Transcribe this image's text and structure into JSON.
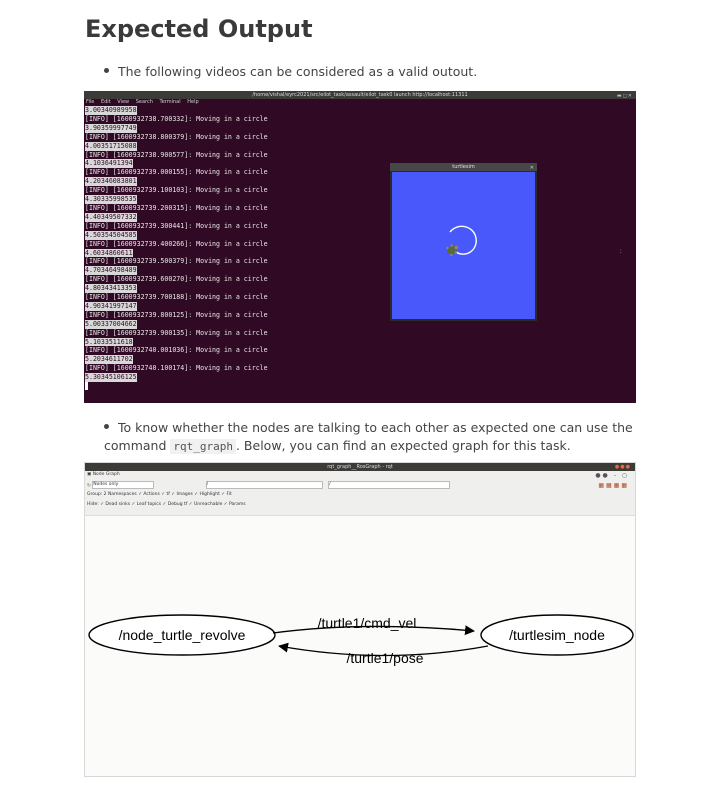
{
  "heading": "Expected Output",
  "bullet1": "The following videos can be considered as a valid outout.",
  "bullet2": {
    "text_before": "To know whether the nodes are talking to each other as expected one can use the command ",
    "code": "rqt_graph",
    "text_after": ". Below, you can find an expected graph for this task."
  },
  "terminal": {
    "title": "/home/vishal/eyrc2021/src/eilot_task/assault/eilot_task0 launch http://localhost:11311",
    "menu": [
      "File",
      "Edit",
      "View",
      "Search",
      "Terminal",
      "Help"
    ],
    "lines": [
      {
        "text": "3.00340989958",
        "sel": true
      },
      {
        "text": "[INFO] [1600932738.700332]: Moving in a circle"
      },
      {
        "text": "3.90359997749",
        "sel": true
      },
      {
        "text": "[INFO] [1600932738.800379]: Moving in a circle"
      },
      {
        "text": "4.00351715088",
        "sel": true
      },
      {
        "text": "[INFO] [1600932738.900577]: Moving in a circle"
      },
      {
        "text": "4.1036491394",
        "sel": true
      },
      {
        "text": "[INFO] [1600932739.000155]: Moving in a circle"
      },
      {
        "text": "4.20346083801",
        "sel": true
      },
      {
        "text": "[INFO] [1600932739.100103]: Moving in a circle"
      },
      {
        "text": "4.30335998535",
        "sel": true
      },
      {
        "text": "[INFO] [1600932739.200315]: Moving in a circle"
      },
      {
        "text": "4.40349507332",
        "sel": true
      },
      {
        "text": "[INFO] [1600932739.300441]: Moving in a circle"
      },
      {
        "text": "4.50354504585",
        "sel": true
      },
      {
        "text": "[INFO] [1600932739.400266]: Moving in a circle"
      },
      {
        "text": "4.6034860611",
        "sel": true
      },
      {
        "text": "[INFO] [1600932739.500379]: Moving in a circle"
      },
      {
        "text": "4.70346498489",
        "sel": true
      },
      {
        "text": "[INFO] [1600932739.600270]: Moving in a circle"
      },
      {
        "text": "4.80343413353",
        "sel": true
      },
      {
        "text": "[INFO] [1600932739.700188]: Moving in a circle"
      },
      {
        "text": "4.90341997147",
        "sel": true
      },
      {
        "text": "[INFO] [1600932739.800125]: Moving in a circle"
      },
      {
        "text": "5.00337004662",
        "sel": true
      },
      {
        "text": "[INFO] [1600932739.900135]: Moving in a circle"
      },
      {
        "text": "5.1033511618",
        "sel": true
      },
      {
        "text": "[INFO] [1600932740.001036]: Moving in a circle"
      },
      {
        "text": "5.2034611702",
        "sel": true
      },
      {
        "text": "[INFO] [1600932740.100174]: Moving in a circle"
      },
      {
        "text": "5.30345106125",
        "sel": true
      }
    ]
  },
  "turtlesim": {
    "title": "turtlesim",
    "background": "#4858fb"
  },
  "rqt": {
    "title": "rqt_graph__RosGraph - rqt",
    "plugin_label": "Node Graph",
    "mode_select": "Nodes only",
    "filter1": "/",
    "filter2": "/",
    "group_row": "Group: 2    Namespaces  ✓ Actions  ✓ tf  ✓ Images   ✓ Highlight  ✓ Fit",
    "hide_row": "Hide: ✓ Dead sinks  ✓ Leaf topics  ✓ Debug  tf  ✓ Unreachable  ✓ Params",
    "nodes": {
      "left": "/node_turtle_revolve",
      "right": "/turtlesim_node"
    },
    "edges": {
      "top": "/turtle1/cmd_vel",
      "bottom": "/turtle1/pose"
    }
  }
}
